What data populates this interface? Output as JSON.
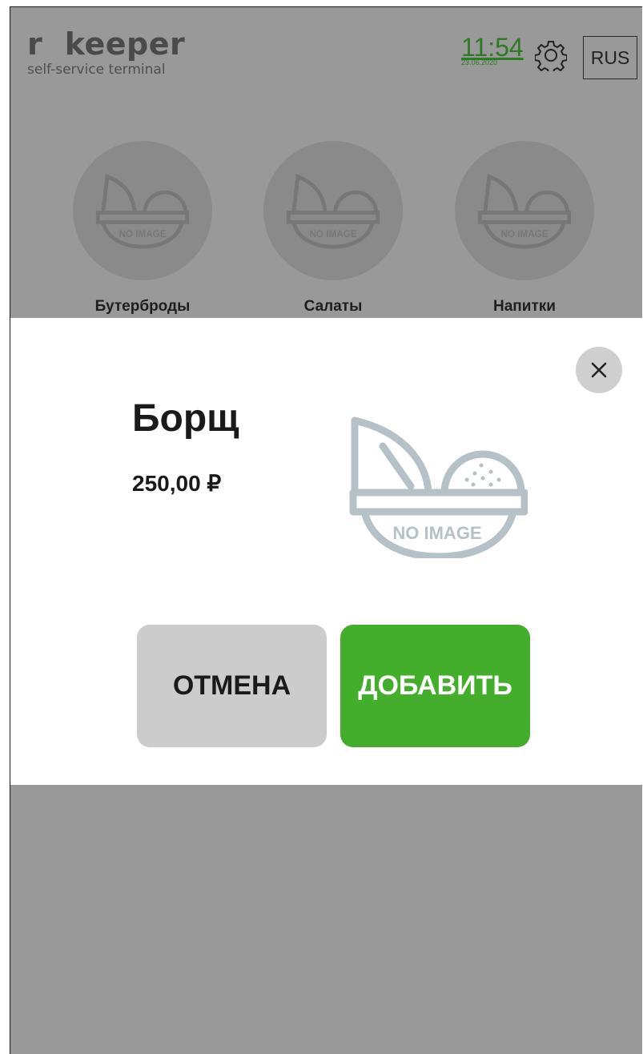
{
  "header": {
    "logo_brand": "r  keeper",
    "logo_tagline": "self-service terminal",
    "time": "11:54",
    "date": "23.06.2020",
    "settings_icon": "gear-icon",
    "language": "RUS",
    "accent_color": "#2f7a24"
  },
  "categories": [
    {
      "label": "Бутерброды",
      "image_text": "NO IMAGE"
    },
    {
      "label": "Салаты",
      "image_text": "NO IMAGE"
    },
    {
      "label": "Напитки",
      "image_text": "NO IMAGE"
    }
  ],
  "modal": {
    "dish_name": "Борщ",
    "price": "250,00 ₽",
    "image_text": "NO IMAGE",
    "close_icon": "close-icon",
    "cancel_label": "ОТМЕНА",
    "add_label": "ДОБАВИТЬ",
    "add_color": "#43ae2c",
    "cancel_color": "#cccccc"
  }
}
